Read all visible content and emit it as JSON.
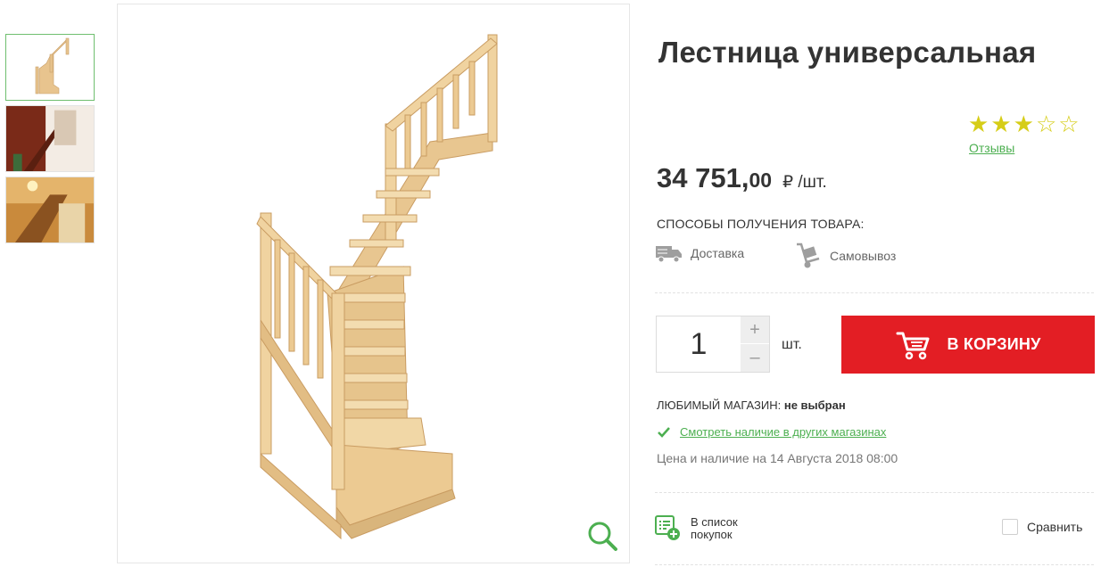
{
  "gallery": {
    "thumbnails": [
      {
        "name": "thumbnail-staircase-1",
        "active": true
      },
      {
        "name": "thumbnail-staircase-interior-2",
        "active": false
      },
      {
        "name": "thumbnail-staircase-interior-3",
        "active": false
      }
    ],
    "zoom_icon": "magnifier-icon"
  },
  "product": {
    "title": "Лестница универсальная",
    "rating": 3,
    "rating_max": 5,
    "reviews_label": "Отзывы",
    "price_int": "34 751,",
    "price_frac": "00",
    "price_unit": "₽ /шт."
  },
  "delivery": {
    "title": "СПОСОБЫ ПОЛУЧЕНИЯ ТОВАРА:",
    "methods": [
      {
        "label": "Доставка",
        "icon": "truck-icon"
      },
      {
        "label": "Самовывоз",
        "icon": "hand-truck-icon"
      }
    ]
  },
  "purchase": {
    "quantity": "1",
    "plus": "+",
    "minus": "–",
    "unit": "шт.",
    "cart_label": "В КОРЗИНУ"
  },
  "store": {
    "favorite_label": "ЛЮБИМЫЙ МАГАЗИН:",
    "favorite_value": "не выбран",
    "availability_link": "Смотреть наличие в других магазинах",
    "price_date": "Цена и наличие на 14 Августа 2018 08:00"
  },
  "actions": {
    "shopping_list": "В список покупок",
    "compare": "Сравнить"
  },
  "colors": {
    "accent_red": "#e31e24",
    "accent_green": "#4caf50",
    "star": "#d6cd17"
  }
}
